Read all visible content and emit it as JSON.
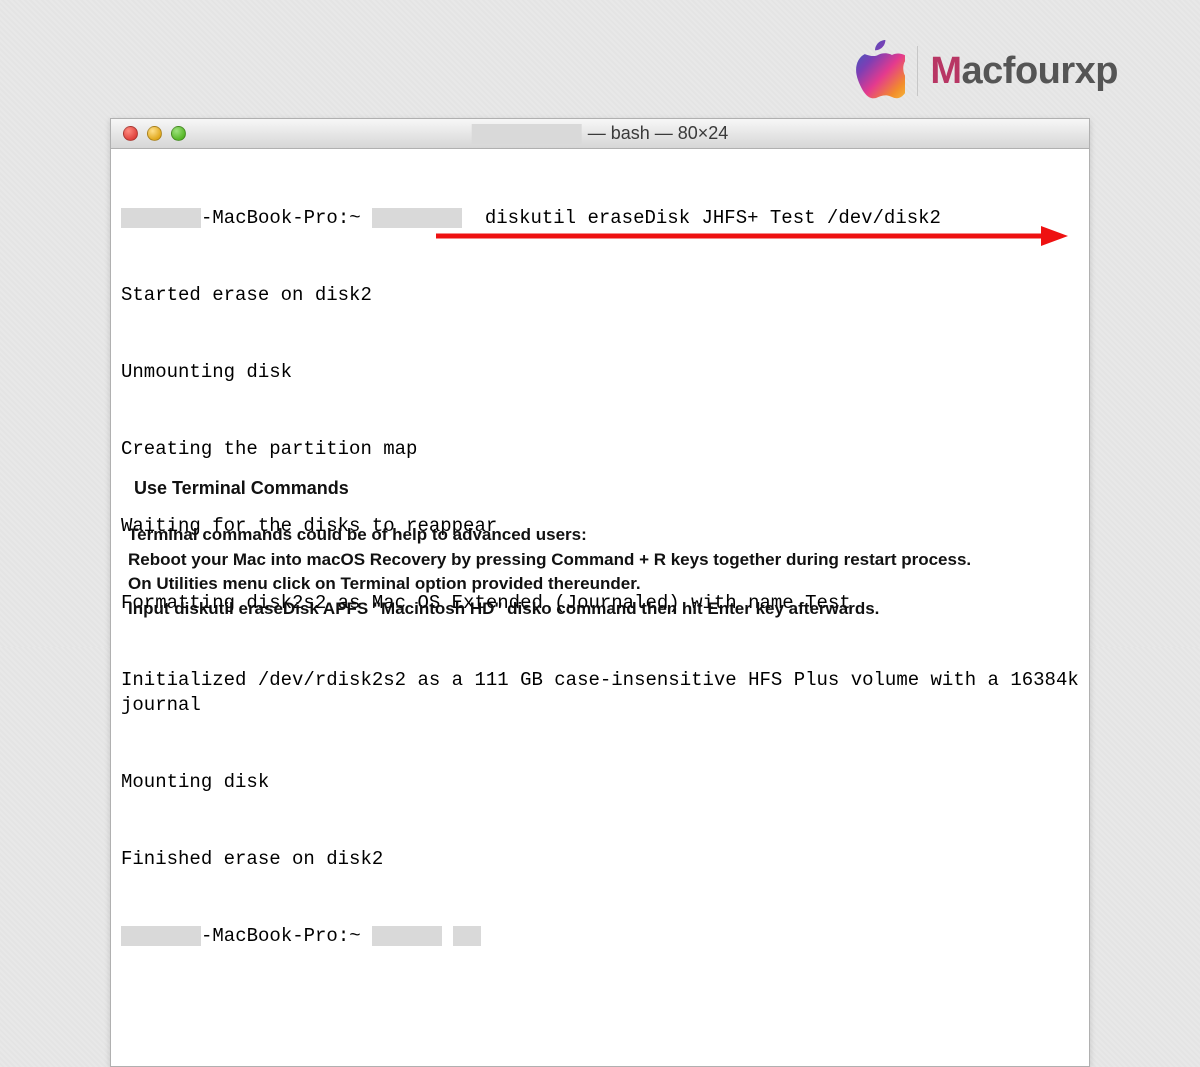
{
  "brand": {
    "name_prefix": "M",
    "name_rest": "acfourxp"
  },
  "terminal": {
    "title": "— bash — 80×24",
    "prompt_host": "-MacBook-Pro:~",
    "command": "diskutil eraseDisk JHFS+ Test /dev/disk2",
    "lines": [
      "Started erase on disk2",
      "Unmounting disk",
      "Creating the partition map",
      "Waiting for the disks to reappear",
      "Formatting disk2s2 as Mac OS Extended (Journaled) with name Test",
      "Initialized /dev/rdisk2s2 as a 111 GB case-insensitive HFS Plus volume with a 16384k journal",
      "Mounting disk",
      "Finished erase on disk2"
    ],
    "prompt2_host": "-MacBook-Pro:~"
  },
  "article": {
    "heading": "Use Terminal Commands",
    "p1": "Terminal commands could be of help to advanced users:",
    "p2": "Reboot your Mac into macOS Recovery by pressing Command + R keys together during restart process.",
    "p3": "On Utilities menu click on Terminal option provided thereunder.",
    "p4": "Input diskutil eraseDisk APFS \"Macintosh HD\" disko command then hit Enter key afterwards."
  }
}
